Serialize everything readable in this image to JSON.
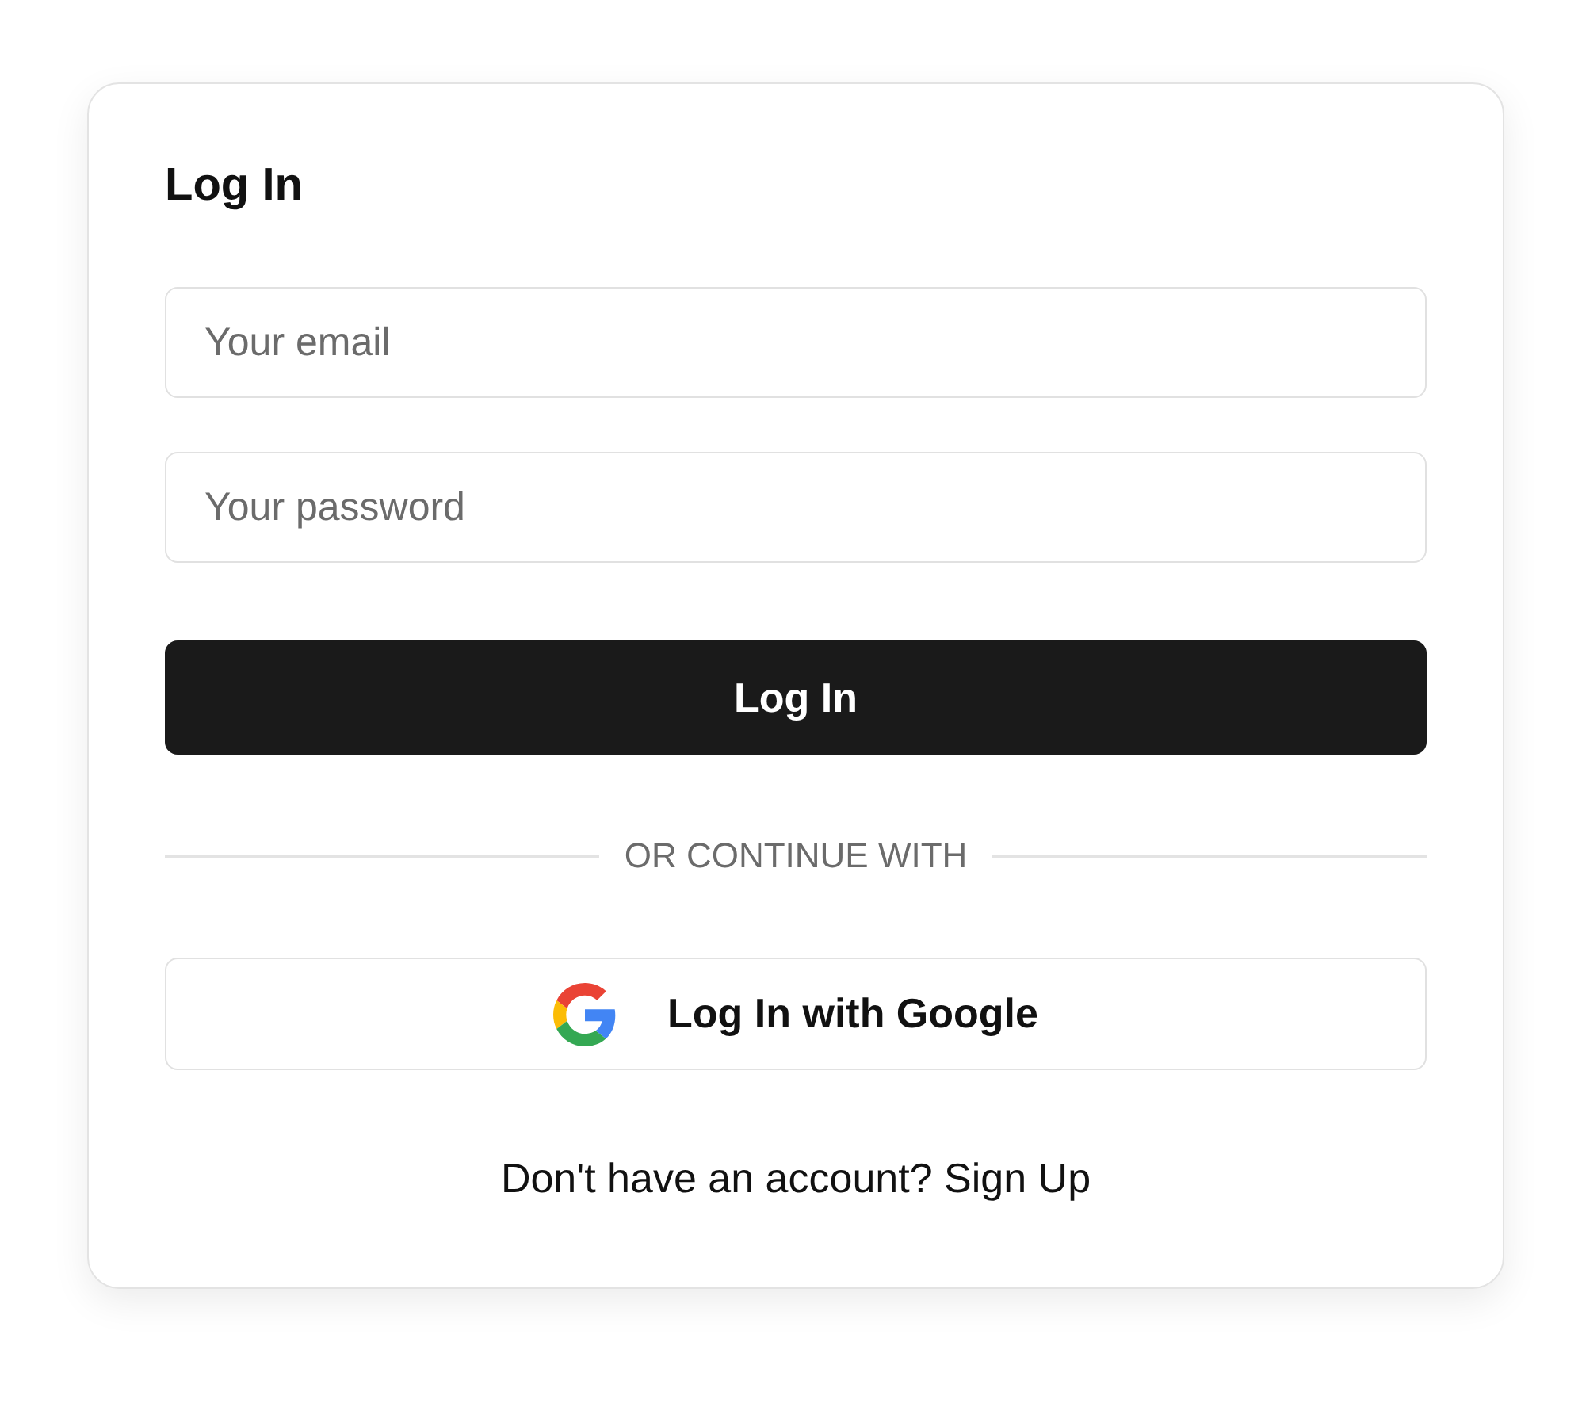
{
  "card": {
    "title": "Log In",
    "fields": [
      {
        "placeholder": "Your email"
      },
      {
        "placeholder": "Your password"
      }
    ],
    "submit_button": "Log In",
    "divider": "OR CONTINUE WITH",
    "social_button": {
      "label": "Log In with Google"
    },
    "footer": {
      "text": "Don't have an account?",
      "link": "Sign Up"
    }
  }
}
